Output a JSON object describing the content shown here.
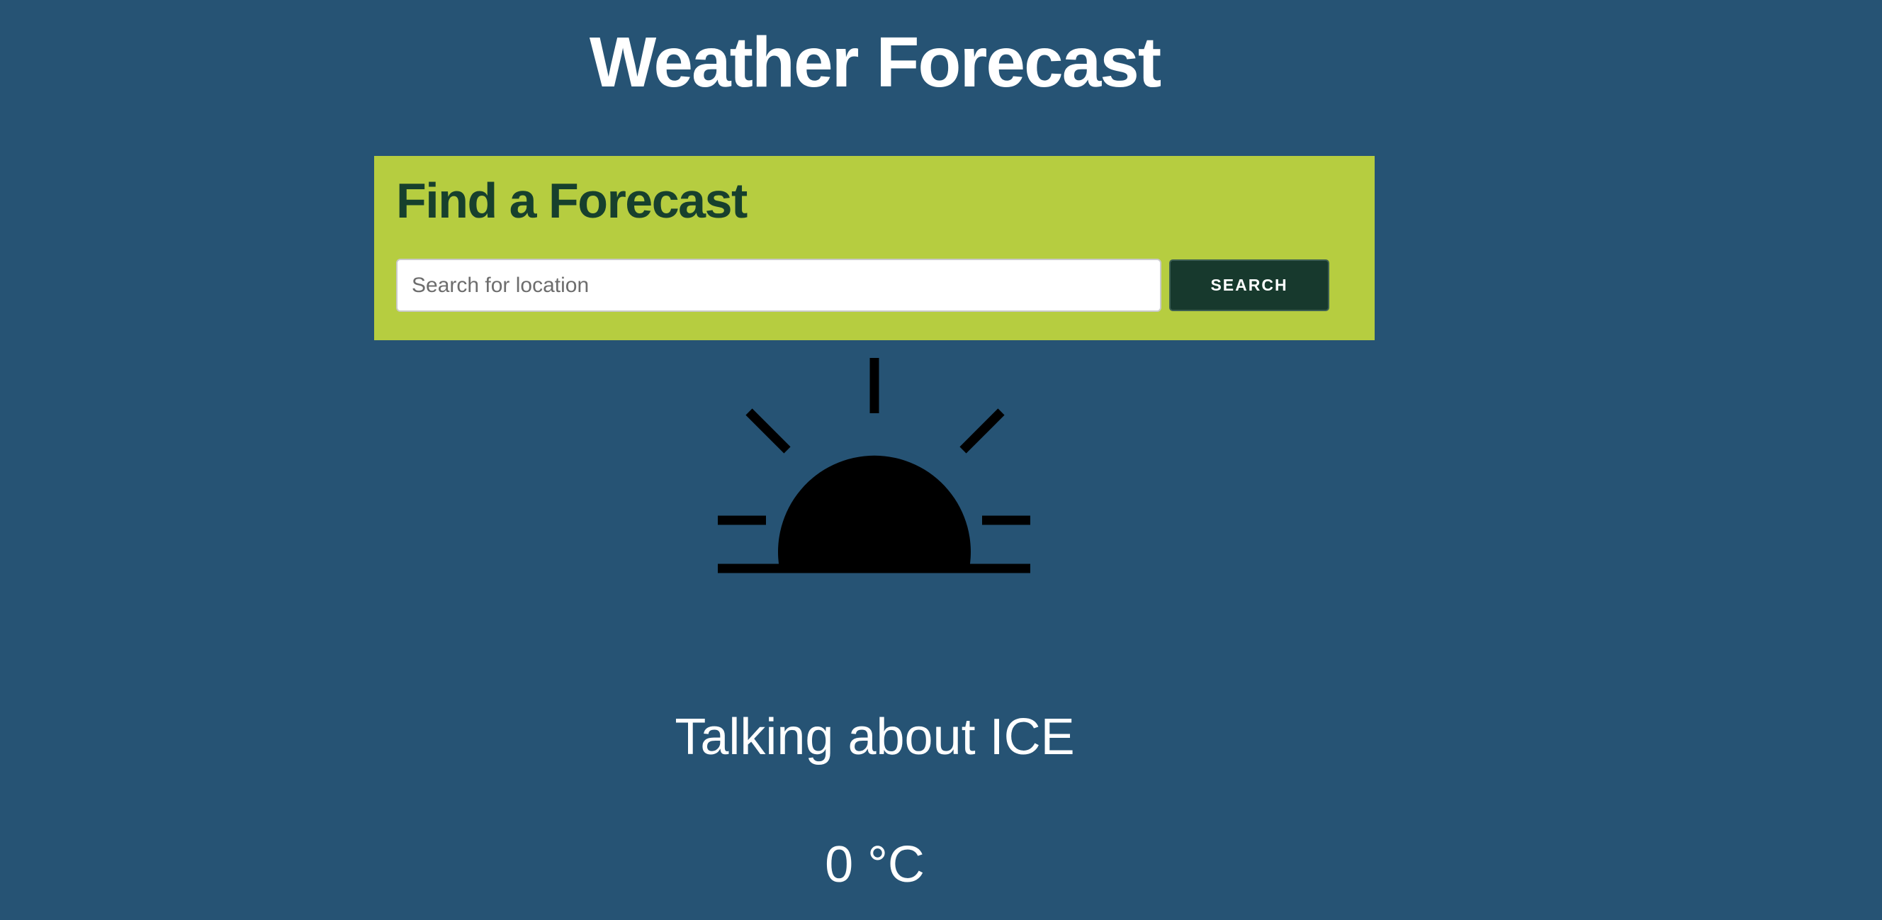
{
  "header": {
    "title": "Weather Forecast"
  },
  "search": {
    "heading": "Find a Forecast",
    "placeholder": "Search for location",
    "value": "",
    "button_label": "SEARCH"
  },
  "forecast": {
    "icon": "sunrise-icon",
    "condition": "Talking about ICE",
    "temperature": "0 °C"
  },
  "colors": {
    "page_background": "#265374",
    "panel_background": "#b6cd40",
    "panel_heading": "#17402d",
    "button_background": "#17392d",
    "text": "#ffffff",
    "icon": "#000000"
  }
}
